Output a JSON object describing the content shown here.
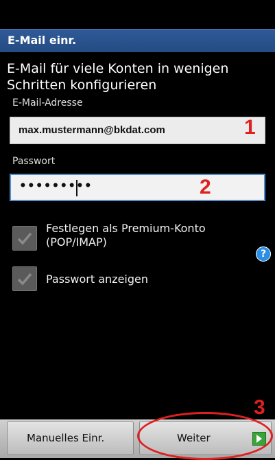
{
  "title": "E-Mail einr.",
  "subtitle": "E-Mail für viele Konten in wenigen Schritten konfigurieren",
  "email": {
    "label": "E-Mail-Adresse",
    "value": "max.mustermann@bkdat.com"
  },
  "password": {
    "label": "Passwort",
    "value": "•••••••••"
  },
  "checkboxes": [
    {
      "label": "Festlegen als Premium-Konto (POP/IMAP)",
      "checked": false
    },
    {
      "label": "Passwort anzeigen",
      "checked": false
    }
  ],
  "help_icon": "?",
  "buttons": {
    "manual": "Manuelles Einr.",
    "next": "Weiter"
  },
  "annotations": [
    "1",
    "2",
    "3"
  ],
  "colors": {
    "title_bar": "#2a5590",
    "annotation": "#e02020",
    "focus": "#4f8fd0",
    "arrow": "#3aa33a"
  },
  "icons": {
    "checkbox_mark": "checkmark-icon",
    "help": "help-icon",
    "next": "arrow-right-icon"
  }
}
